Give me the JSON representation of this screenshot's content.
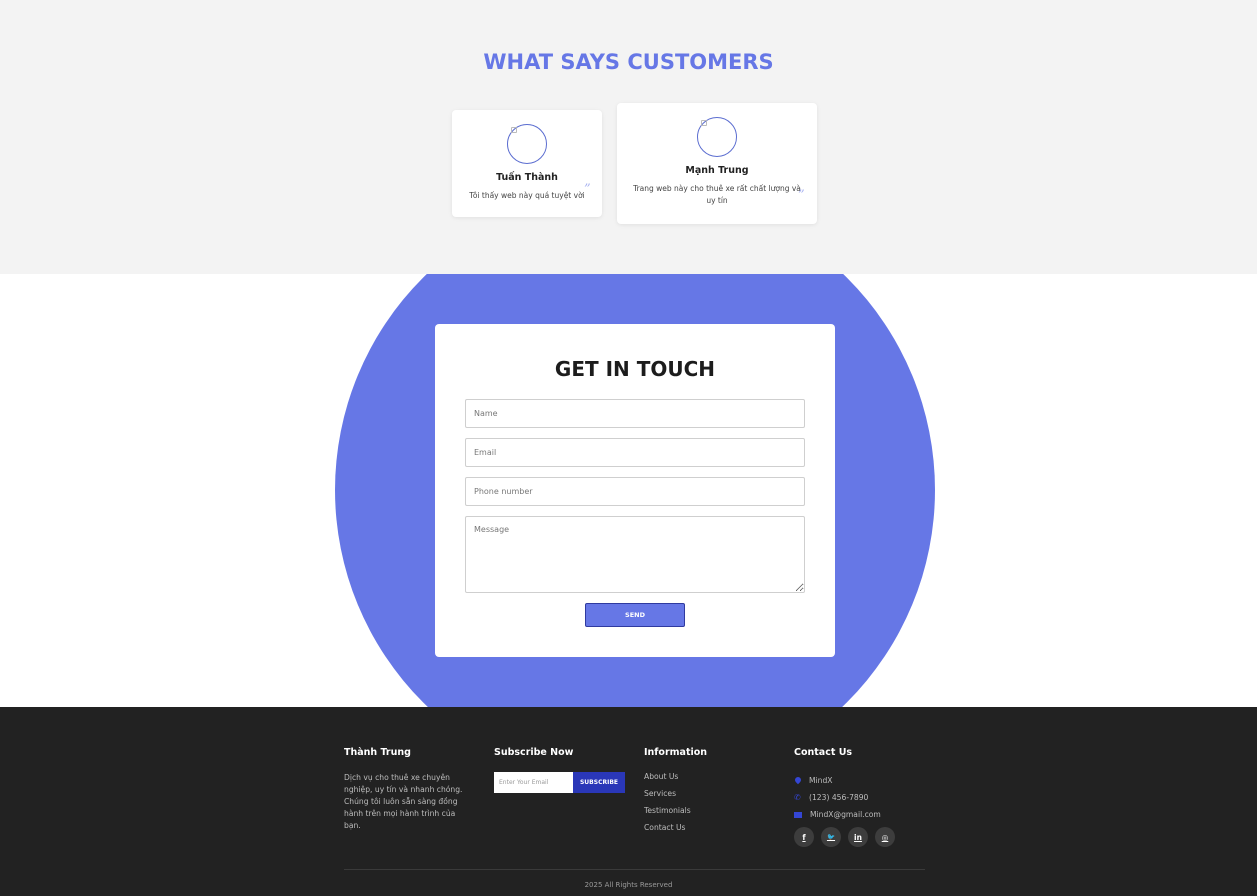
{
  "testimonials": {
    "title": "WHAT SAYS CUSTOMERS",
    "cards": [
      {
        "name": "Tuấn Thành",
        "text": "Tôi thấy web này quá tuyệt vời",
        "quote": "”"
      },
      {
        "name": "Mạnh Trung",
        "text": "Trang web này cho thuê xe rất chất lượng và uy tín",
        "quote": "”"
      }
    ]
  },
  "contact": {
    "title": "GET IN TOUCH",
    "name_placeholder": "Name",
    "email_placeholder": "Email",
    "phone_placeholder": "Phone number",
    "message_placeholder": "Message",
    "send_label": "SEND",
    "accent_color": "#6677e6"
  },
  "footer": {
    "brand": {
      "title": "Thành Trung",
      "text": "Dịch vụ cho thuê xe chuyên nghiệp, uy tín và nhanh chóng. Chúng tôi luôn sẵn sàng đồng hành trên mọi hành trình của bạn."
    },
    "subscribe": {
      "title": "Subscribe Now",
      "placeholder": "Enter Your Email",
      "button": "SUBSCRIBE"
    },
    "information": {
      "title": "Information",
      "links": [
        "About Us",
        "Services",
        "Testimonials",
        "Contact Us"
      ]
    },
    "contact": {
      "title": "Contact Us",
      "address": "MindX",
      "phone": "(123) 456-7890",
      "email": "MindX@gmail.com",
      "socials": [
        {
          "icon": "facebook-icon",
          "glyph": "f"
        },
        {
          "icon": "twitter-icon",
          "glyph": "🐦"
        },
        {
          "icon": "linkedin-icon",
          "glyph": "in"
        },
        {
          "icon": "instagram-icon",
          "glyph": "◎"
        }
      ]
    },
    "copyright": "2025 All Rights Reserved",
    "background_color": "#222222"
  }
}
